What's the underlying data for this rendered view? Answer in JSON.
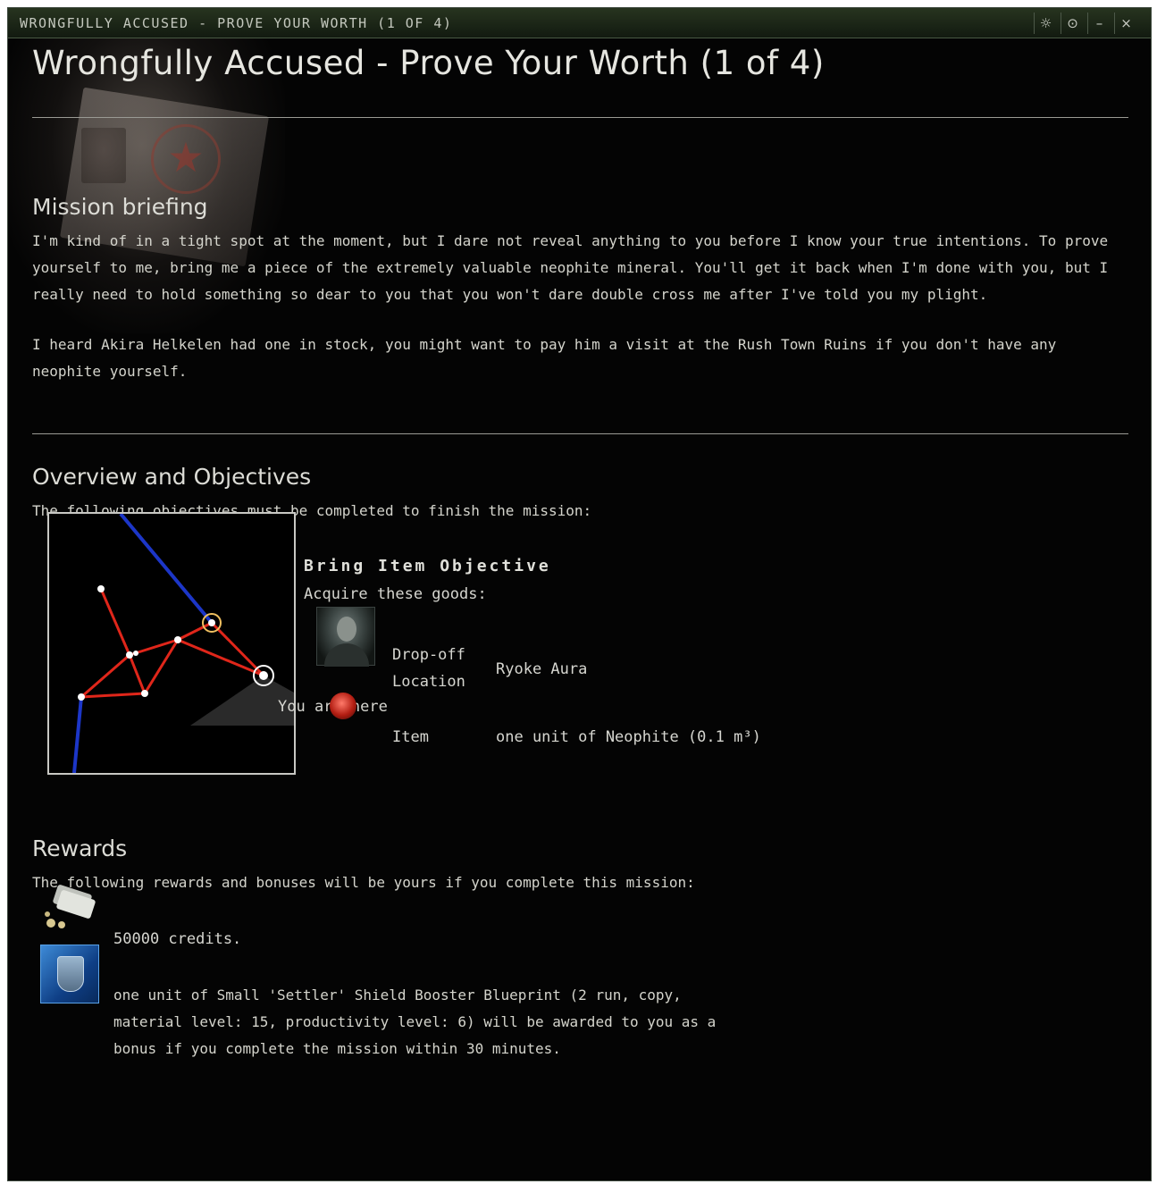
{
  "window": {
    "titlebar_text": "WRONGFULLY ACCUSED - PROVE YOUR WORTH (1 OF 4)",
    "buttons": {
      "settings_glyph": "☼",
      "pin_glyph": "⊙",
      "minimize_glyph": "–",
      "close_glyph": "×"
    }
  },
  "page": {
    "title": "Wrongfully Accused - Prove Your Worth (1 of 4)"
  },
  "briefing": {
    "heading": "Mission briefing",
    "paragraph_1": "I'm kind of in a tight spot at the moment, but I dare not reveal anything to you before I know your true intentions. To prove yourself to me, bring me a piece of the extremely valuable neophite mineral. You'll get it back when I'm done with you, but I really need to hold something so dear to you that you won't dare double cross me after I've told you my plight.",
    "paragraph_2": "I heard Akira Helkelen had one in stock, you might want to pay him a visit at the Rush Town Ruins if you don't have any neophite yourself."
  },
  "overview": {
    "heading": "Overview and Objectives",
    "intro": "The following objectives must be completed to finish the mission:",
    "map_label": "You are here",
    "objective_title": "Bring Item Objective",
    "objective_subtitle": "Acquire these goods:",
    "dropoff_label_line1": "Drop-off",
    "dropoff_label_line2": "Location",
    "dropoff_value": "Ryoke Aura",
    "item_label": "Item",
    "item_value": "one unit of Neophite (0.1 m³)"
  },
  "rewards": {
    "heading": "Rewards",
    "intro": "The following rewards and bonuses will be yours if you complete this mission:",
    "credits": "50000 credits.",
    "bonus": "one unit of Small 'Settler' Shield Booster Blueprint (2 run, copy, material level: 15, productivity level: 6) will be awarded to you as a bonus if you complete the mission within 30 minutes."
  },
  "icons": {
    "dropoff": "agent-portrait",
    "item": "neophite-mineral-icon",
    "credits": "isk-credits-icon",
    "bonus": "shield-booster-blueprint-icon"
  },
  "colors": {
    "route": "#e0261a",
    "path_blue": "#1c36c8",
    "marker": "#f0c060",
    "background": "#040404",
    "text": "#d7d7d1"
  }
}
